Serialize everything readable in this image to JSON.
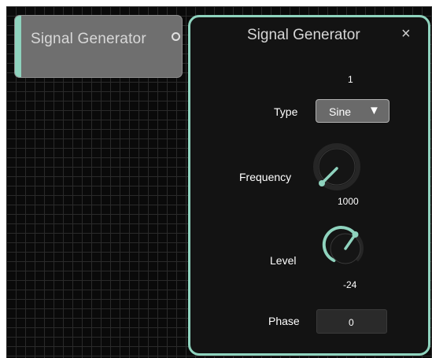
{
  "node": {
    "title": "Signal Generator",
    "accent_color": "#8fd3be"
  },
  "panel": {
    "title": "Signal Generator",
    "close_glyph": "×",
    "border_color": "#8fd3be",
    "channel_number": "1",
    "type": {
      "label": "Type",
      "value": "Sine",
      "arrow_glyph": "▼"
    },
    "frequency": {
      "label": "Frequency",
      "value": "1000"
    },
    "level": {
      "label": "Level",
      "value": "-24"
    },
    "phase": {
      "label": "Phase",
      "value": "0"
    }
  },
  "icons": [
    "close-icon",
    "chevron-down-icon",
    "output-port-icon"
  ]
}
